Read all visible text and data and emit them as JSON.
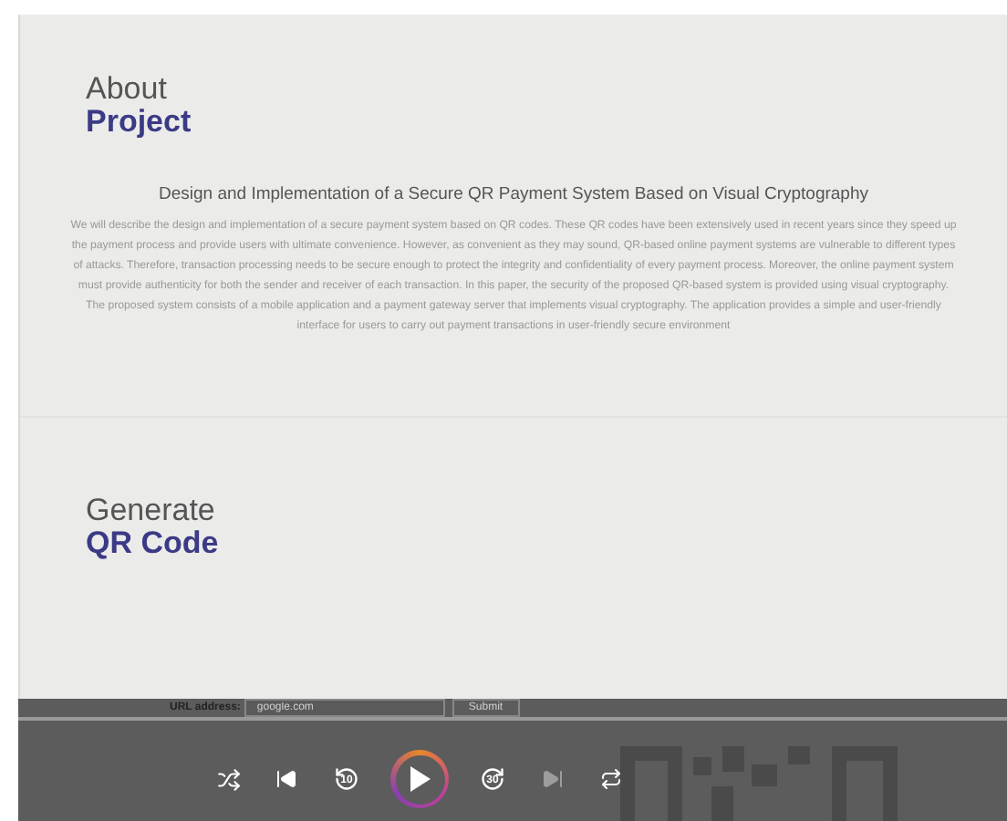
{
  "about": {
    "title": "About",
    "subtitle": "Project"
  },
  "project": {
    "title": "Design and Implementation of a Secure QR Payment System Based on Visual Cryptography",
    "abstract": "We will describe the design and implementation of a secure payment system based on QR codes. These QR codes have been extensively used in recent years since they speed up the payment process and provide users with ultimate convenience. However, as convenient as they may sound, QR-based online payment systems are vulnerable to different types of attacks. Therefore, transaction processing needs to be secure enough to protect the integrity and confidentiality of every payment process. Moreover, the online payment system must provide authenticity for both the sender and receiver of each transaction. In this paper, the security of the proposed QR-based system is provided using visual cryptography. The proposed system consists of a mobile application and a payment gateway server that implements visual cryptography. The application provides a simple and user-friendly interface for users to carry out payment transactions in user-friendly secure environment"
  },
  "generate": {
    "title": "Generate",
    "subtitle": "QR Code",
    "url_label": "URL address:",
    "placeholder": "google.com",
    "submit": "Submit"
  },
  "player": {
    "controls": [
      {
        "kind": "shuffle",
        "disabled": false
      },
      {
        "kind": "previous",
        "disabled": false
      },
      {
        "kind": "rewind",
        "label": "10",
        "disabled": false
      },
      {
        "kind": "play",
        "disabled": false
      },
      {
        "kind": "forward",
        "label": "30",
        "disabled": false
      },
      {
        "kind": "next",
        "disabled": true
      },
      {
        "kind": "repeat",
        "disabled": false
      }
    ]
  }
}
